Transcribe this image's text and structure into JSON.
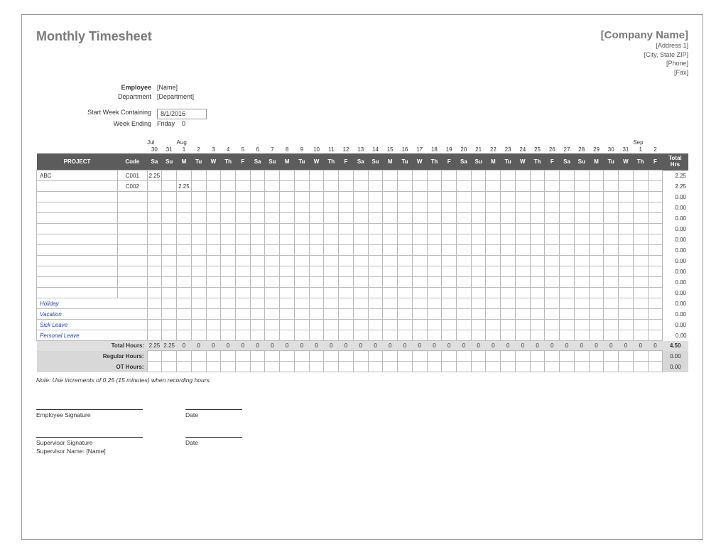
{
  "title": "Monthly Timesheet",
  "company": {
    "name": "[Company Name]",
    "address1": "[Address 1]",
    "address2": "[City, State ZIP]",
    "phone": "[Phone]",
    "fax": "[Fax]"
  },
  "info": {
    "employee_label": "Employee",
    "employee_value": "[Name]",
    "department_label": "Department",
    "department_value": "[Department]",
    "start_week_label": "Start Week Containing",
    "start_week_value": "8/1/2016",
    "week_ending_label": "Week Ending",
    "week_ending_value": "Friday",
    "week_ending_extra": "0"
  },
  "months": {
    "jul": "Jul",
    "aug": "Aug",
    "sep": "Sep"
  },
  "dates": [
    "30",
    "31",
    "1",
    "2",
    "3",
    "4",
    "5",
    "6",
    "7",
    "8",
    "9",
    "10",
    "11",
    "12",
    "13",
    "14",
    "15",
    "16",
    "17",
    "18",
    "19",
    "20",
    "21",
    "22",
    "23",
    "24",
    "25",
    "26",
    "27",
    "28",
    "29",
    "30",
    "31",
    "1",
    "2"
  ],
  "days": [
    "Sa",
    "Su",
    "M",
    "Tu",
    "W",
    "Th",
    "F",
    "Sa",
    "Su",
    "M",
    "Tu",
    "W",
    "Th",
    "F",
    "Sa",
    "Su",
    "M",
    "Tu",
    "W",
    "Th",
    "F",
    "Sa",
    "Su",
    "M",
    "Tu",
    "W",
    "Th",
    "F",
    "Sa",
    "Su",
    "M",
    "Tu",
    "W",
    "Th",
    "F"
  ],
  "headers": {
    "project": "PROJECT",
    "code": "Code",
    "total": "Total Hrs"
  },
  "rows": [
    {
      "project": "ABC",
      "code": "C001",
      "hours": [
        "2.25",
        "",
        "",
        "",
        "",
        "",
        "",
        "",
        "",
        "",
        "",
        "",
        "",
        "",
        "",
        "",
        "",
        "",
        "",
        "",
        "",
        "",
        "",
        "",
        "",
        "",
        "",
        "",
        "",
        "",
        "",
        "",
        "",
        "",
        ""
      ],
      "total": "2.25"
    },
    {
      "project": "",
      "code": "C002",
      "hours": [
        "",
        "",
        "2.25",
        "",
        "",
        "",
        "",
        "",
        "",
        "",
        "",
        "",
        "",
        "",
        "",
        "",
        "",
        "",
        "",
        "",
        "",
        "",
        "",
        "",
        "",
        "",
        "",
        "",
        "",
        "",
        "",
        "",
        "",
        "",
        ""
      ],
      "total": "2.25"
    },
    {
      "project": "",
      "code": "",
      "hours": [],
      "total": "0.00"
    },
    {
      "project": "",
      "code": "",
      "hours": [],
      "total": "0.00"
    },
    {
      "project": "",
      "code": "",
      "hours": [],
      "total": "0.00"
    },
    {
      "project": "",
      "code": "",
      "hours": [],
      "total": "0.00"
    },
    {
      "project": "",
      "code": "",
      "hours": [],
      "total": "0.00"
    },
    {
      "project": "",
      "code": "",
      "hours": [],
      "total": "0.00"
    },
    {
      "project": "",
      "code": "",
      "hours": [],
      "total": "0.00"
    },
    {
      "project": "",
      "code": "",
      "hours": [],
      "total": "0.00"
    },
    {
      "project": "",
      "code": "",
      "hours": [],
      "total": "0.00"
    },
    {
      "project": "",
      "code": "",
      "hours": [],
      "total": "0.00"
    }
  ],
  "leave_rows": [
    {
      "label": "Holiday",
      "total": "0.00"
    },
    {
      "label": "Vacation",
      "total": "0.00"
    },
    {
      "label": "Sick Leave",
      "total": "0.00"
    },
    {
      "label": "Personal Leave",
      "total": "0.00"
    }
  ],
  "totals": {
    "label": "Total Hours:",
    "values": [
      "2.25",
      "2.25",
      "0",
      "0",
      "0",
      "0",
      "0",
      "0",
      "0",
      "0",
      "0",
      "0",
      "0",
      "0",
      "0",
      "0",
      "0",
      "0",
      "0",
      "0",
      "0",
      "0",
      "0",
      "0",
      "0",
      "0",
      "0",
      "0",
      "0",
      "0",
      "0",
      "0",
      "0",
      "0",
      "0"
    ],
    "grand": "4.50"
  },
  "regular": {
    "label": "Regular Hours:",
    "grand": "0.00"
  },
  "ot": {
    "label": "OT Hours:",
    "grand": "0.00"
  },
  "note": "Note: Use increments of 0.25 (15 minutes) when recording hours.",
  "sig": {
    "emp": "Employee Signature",
    "date": "Date",
    "sup": "Supervisor Signature",
    "sup_name_label": "Supervisor Name: [Name]"
  }
}
